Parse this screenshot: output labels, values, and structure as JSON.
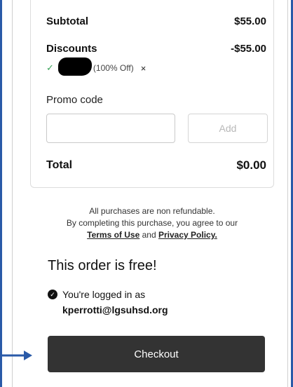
{
  "summary": {
    "subtotal_label": "Subtotal",
    "subtotal_value": "$55.00",
    "discounts_label": "Discounts",
    "discounts_value": "-$55.00",
    "coupon_badge": "(100% Off)",
    "remove_glyph": "×",
    "check_glyph": "✓",
    "promo_label": "Promo code",
    "promo_value": "",
    "add_label": "Add",
    "total_label": "Total",
    "total_value": "$0.00"
  },
  "disclaimer": {
    "line1": "All purchases are non refundable.",
    "line2": "By completing this purchase, you agree to our",
    "terms_link": "Terms of Use",
    "and_text": "and",
    "privacy_link": "Privacy Policy."
  },
  "order": {
    "free_heading": "This order is free!",
    "logged_in_text": "You're logged in as",
    "email": "kperrotti@lgsuhsd.org",
    "checkout_label": "Checkout"
  },
  "icons": {
    "coupon_check": "check-icon",
    "login_check": "check-circle-icon",
    "remove": "close-icon",
    "annotation": "arrow-right-icon"
  },
  "colors": {
    "accent_green": "#3ca35a",
    "checkout_bg": "#333333",
    "annotation_blue": "#2a5aa8"
  }
}
